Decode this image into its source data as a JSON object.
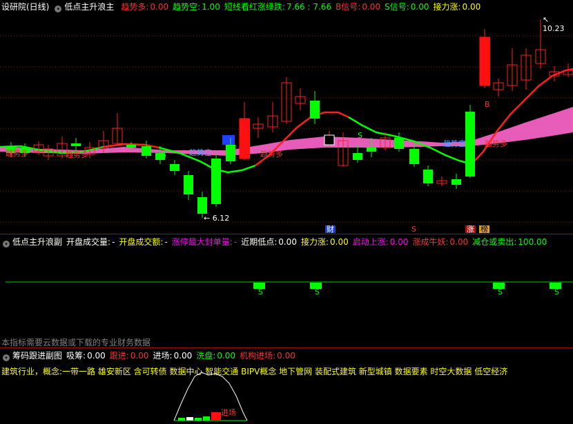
{
  "main": {
    "title": "设研院(日线)",
    "indicator": "低点主升浪主",
    "fields": [
      {
        "label": "趋势多:",
        "value": "0.00",
        "color": "#ff3030"
      },
      {
        "label": "趋势空:",
        "value": "1.00",
        "color": "#00ff00"
      },
      {
        "label": "短线看红涨绿跌:",
        "value": "7.66 : 7.66",
        "color": "#00ff00"
      },
      {
        "label": "B信号:",
        "value": "0.00",
        "color": "#ff3030"
      },
      {
        "label": "S信号:",
        "value": "0.00",
        "color": "#00ff00"
      },
      {
        "label": "接力涨:",
        "value": "0.00",
        "color": "#ffff00"
      }
    ],
    "high_label": "10.23",
    "low_label": "6.12",
    "signals": {
      "trend_long_1": "趋势多",
      "trend_long_2": "趋势多",
      "trend_long_3": "趋势多",
      "trend_long_4": "趋势多",
      "trend_short_1": "趋势空",
      "trend_short_2": "趋势空",
      "s1": "S",
      "s2": "S",
      "b1": "B"
    },
    "badges": {
      "cai": "财",
      "s": "S",
      "zhang": "涨",
      "bang": "榜"
    }
  },
  "sub1": {
    "indicator": "低点主升浪副",
    "fields": [
      {
        "label": "开盘成交量:",
        "value": "-",
        "color": "#ffffff"
      },
      {
        "label": "开盘成交额:",
        "value": "-",
        "color": "#ffff00"
      },
      {
        "label": "涨停最大封单量:",
        "value": "-",
        "color": "#ff00ff"
      },
      {
        "label": "近期低点:",
        "value": "0.00",
        "color": "#ffffff"
      },
      {
        "label": "接力涨:",
        "value": "0.00",
        "color": "#ffff00"
      },
      {
        "label": "启动上涨:",
        "value": "0.00",
        "color": "#ff00ff"
      },
      {
        "label": "涨成牛妖:",
        "value": "0.00",
        "color": "#ff3030"
      },
      {
        "label": "减仓或卖出:",
        "value": "100.00",
        "color": "#00ff00"
      }
    ],
    "s_marks": [
      "S",
      "S",
      "S",
      "S"
    ],
    "note": "本指标需要云数据或下载的专业财务数据"
  },
  "sub2": {
    "indicator": "筹码跟进副图",
    "fields": [
      {
        "label": "吸筹:",
        "value": "0.00",
        "color": "#ffffff"
      },
      {
        "label": "跟进:",
        "value": "0.00",
        "color": "#ff3030"
      },
      {
        "label": "进场:",
        "value": "0.00",
        "color": "#ffffff"
      },
      {
        "label": "洗盘:",
        "value": "0.00",
        "color": "#00ff00"
      },
      {
        "label": "机构进场:",
        "value": "0.00",
        "color": "#ff3030"
      }
    ],
    "concepts": "建筑行业，概念:一带一路 雄安新区 含可转债 数据中心 智能交通 BIPV概念 地下管网 装配式建筑 新型城镇 数据要素 时空大数据 低空经济",
    "entry_label": "进场"
  }
}
